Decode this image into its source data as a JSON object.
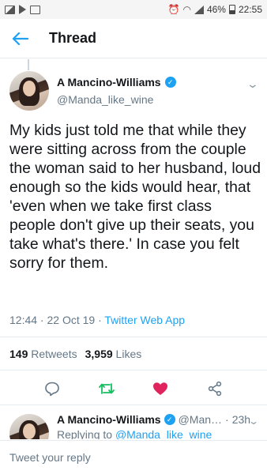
{
  "status_bar": {
    "left_icons": [
      "image-icon",
      "play-icon",
      "gallery-icon"
    ],
    "battery_percent": "46%",
    "time": "22:55"
  },
  "header": {
    "title": "Thread"
  },
  "tweet": {
    "display_name": "A Mancino-Williams",
    "handle": "@Manda_like_wine",
    "text": "My kids just told me that while they were sitting across from the couple the woman said to her husband, loud enough so the kids would hear, that 'even when we take first class people don't give up their seats, you take what's there.' In case you felt sorry for them.",
    "timestamp": "12:44 · 22 Oct 19",
    "separator": "·",
    "source": "Twitter Web App",
    "retweets_count": "149",
    "retweets_label": "Retweets",
    "likes_count": "3,959",
    "likes_label": "Likes",
    "verified_mark": "✓"
  },
  "reply": {
    "display_name": "A Mancino-Williams",
    "handle": "@Man…",
    "separator": "·",
    "time": "23h",
    "replying_prefix": "Replying to",
    "replying_to": "@Manda_like_wine"
  },
  "compose": {
    "placeholder": "Tweet your reply"
  },
  "colors": {
    "accent": "#1da1f2",
    "retweet_green": "#17bf63",
    "like_red": "#e0245e",
    "secondary_text": "#657786"
  }
}
